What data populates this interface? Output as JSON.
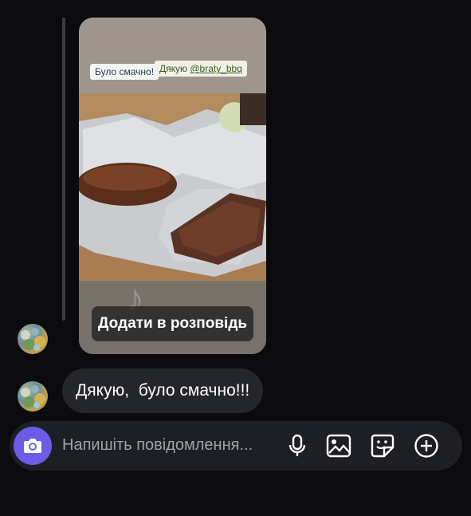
{
  "story": {
    "sticker_left": "Було смачно!",
    "sticker_right_prefix": "Дякую ",
    "sticker_right_handle": "@braty_bbq",
    "add_to_story_label": "Додати в розповідь"
  },
  "messages": [
    {
      "text": "Дякую,  було смачно!!!"
    }
  ],
  "composer": {
    "placeholder": "Напишіть повідомлення..."
  },
  "icons": {
    "camera": "camera-icon",
    "mic": "microphone-icon",
    "gallery": "image-gallery-icon",
    "sticker": "sticker-icon",
    "plus": "plus-circle-icon",
    "music": "music-note-icon"
  },
  "colors": {
    "background": "#0b0b0d",
    "bubble": "#24262b",
    "composer": "#1d1f24",
    "accent": "#6c5ce7",
    "placeholder_text": "#9fa2a8"
  }
}
